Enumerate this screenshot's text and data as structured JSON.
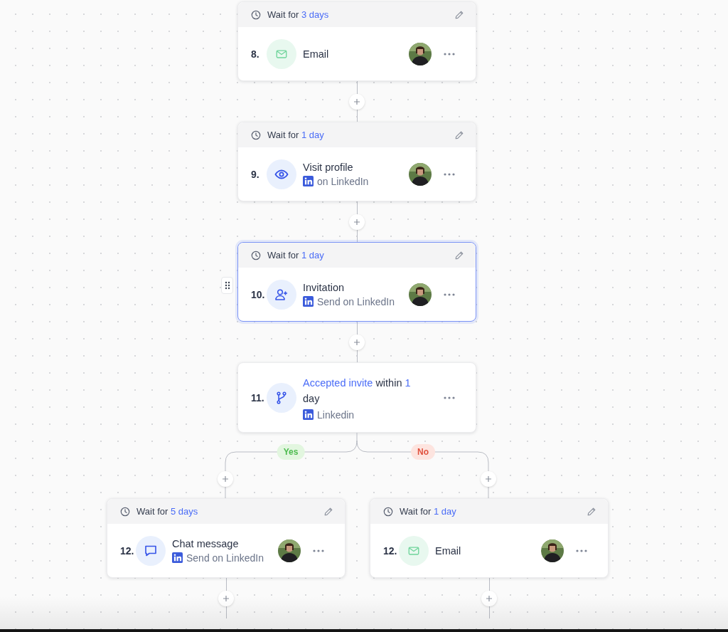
{
  "steps": [
    {
      "number": "8.",
      "kind": "email",
      "wait_label": "Wait for",
      "wait_value": "3 days",
      "title": "Email",
      "selected": false
    },
    {
      "number": "9.",
      "kind": "visit",
      "wait_label": "Wait for",
      "wait_value": "1 day",
      "title": "Visit profile",
      "subtitle": "on LinkedIn",
      "selected": false
    },
    {
      "number": "10.",
      "kind": "invite",
      "wait_label": "Wait for",
      "wait_value": "1 day",
      "title": "Invitation",
      "subtitle": "Send on LinkedIn",
      "selected": true
    },
    {
      "number": "11.",
      "kind": "condition",
      "title_parts": [
        {
          "text": "Accepted invite",
          "highlight": true
        },
        {
          "text": "within",
          "highlight": false
        },
        {
          "text": "1",
          "highlight": true
        },
        {
          "text": "day",
          "highlight": false
        }
      ],
      "subtitle": "Linkedin",
      "selected": false
    }
  ],
  "branches": [
    {
      "label": "Yes",
      "kind": "yes",
      "step": {
        "number": "12.",
        "kind": "chat",
        "wait_label": "Wait for",
        "wait_value": "5 days",
        "title": "Chat message",
        "subtitle": "Send on LinkedIn",
        "selected": false
      }
    },
    {
      "label": "No",
      "kind": "no",
      "step": {
        "number": "12.",
        "kind": "email",
        "wait_label": "Wait for",
        "wait_value": "1 day",
        "title": "Email",
        "selected": false
      }
    }
  ]
}
